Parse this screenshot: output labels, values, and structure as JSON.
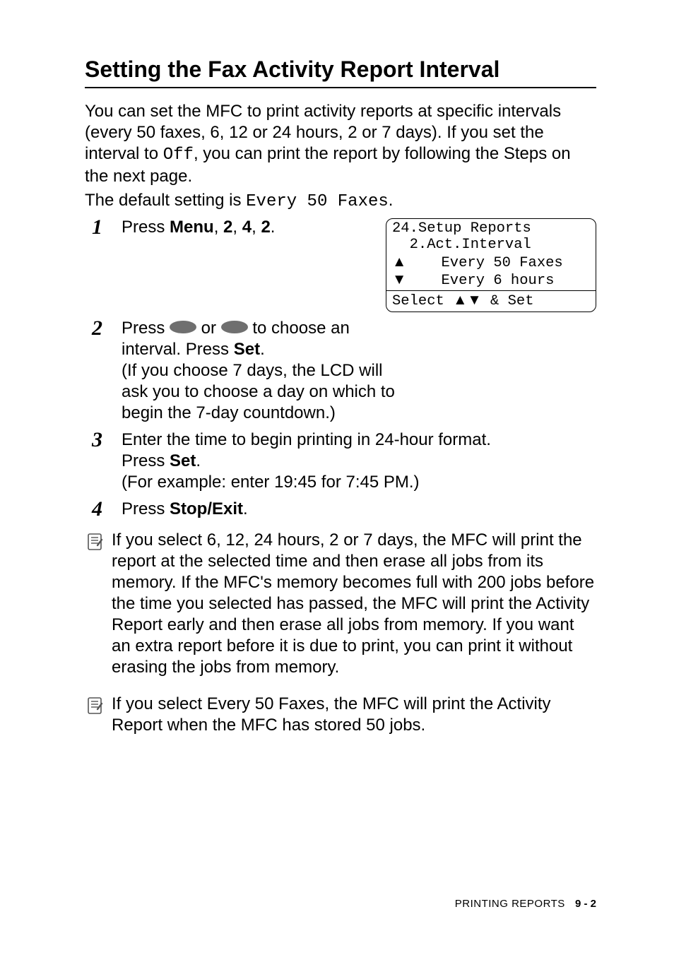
{
  "title": "Setting the Fax Activity Report Interval",
  "intro": {
    "para1_a": "You can set the MFC to print activity reports at specific intervals (every 50 faxes, 6, 12 or 24 hours, 2 or 7 days). If you set the interval to ",
    "para1_off": "Off",
    "para1_b": ", you can print the report by following the Steps on the next page.",
    "para2_a": "The default setting is ",
    "para2_mono": "Every 50 Faxes",
    "para2_b": "."
  },
  "steps": {
    "s1": {
      "num": "1",
      "a": "Press ",
      "b": "Menu",
      "c": ", ",
      "d": "2",
      "e": ", ",
      "f": "4",
      "g": ", ",
      "h": "2",
      "i": "."
    },
    "s2": {
      "num": "2",
      "a": "Press ",
      "b": " or ",
      "c": " to choose an interval. Press ",
      "set": "Set",
      "d": ".",
      "sub": "(If you choose 7 days, the LCD will ask you to choose a day on which to begin the 7-day countdown.)"
    },
    "s3": {
      "num": "3",
      "a": "Enter the time to begin printing in 24-hour format.",
      "b": "Press ",
      "set": "Set",
      "c": ".",
      "sub": "(For example: enter 19:45 for 7:45 PM.)"
    },
    "s4": {
      "num": "4",
      "a": "Press ",
      "b": "Stop/Exit",
      "c": "."
    }
  },
  "lcd": {
    "line1": "24.Setup Reports",
    "line2": "  2.Act.Interval",
    "line3_arrow": "▲",
    "line3_text": "    Every 50 Faxes",
    "line4_arrow": "▼",
    "line4_text": "    Every 6 hours",
    "line5_a": "Select ",
    "line5_arrows": "▲▼",
    "line5_b": " & Set"
  },
  "notes": {
    "n1": "If you select 6, 12, 24 hours, 2 or 7 days, the MFC will print the report at the selected time and then erase all jobs from its memory. If the MFC's memory becomes full with 200 jobs before the time you selected has passed, the MFC will print the Activity Report early and then erase all jobs from memory. If you want an extra report before it is due to print, you can print it without erasing the jobs from memory.",
    "n2": "If you select Every 50 Faxes, the MFC will print the Activity Report when the MFC has stored 50 jobs."
  },
  "footer": {
    "chapter": "PRINTING REPORTS",
    "page": "9 - 2"
  }
}
